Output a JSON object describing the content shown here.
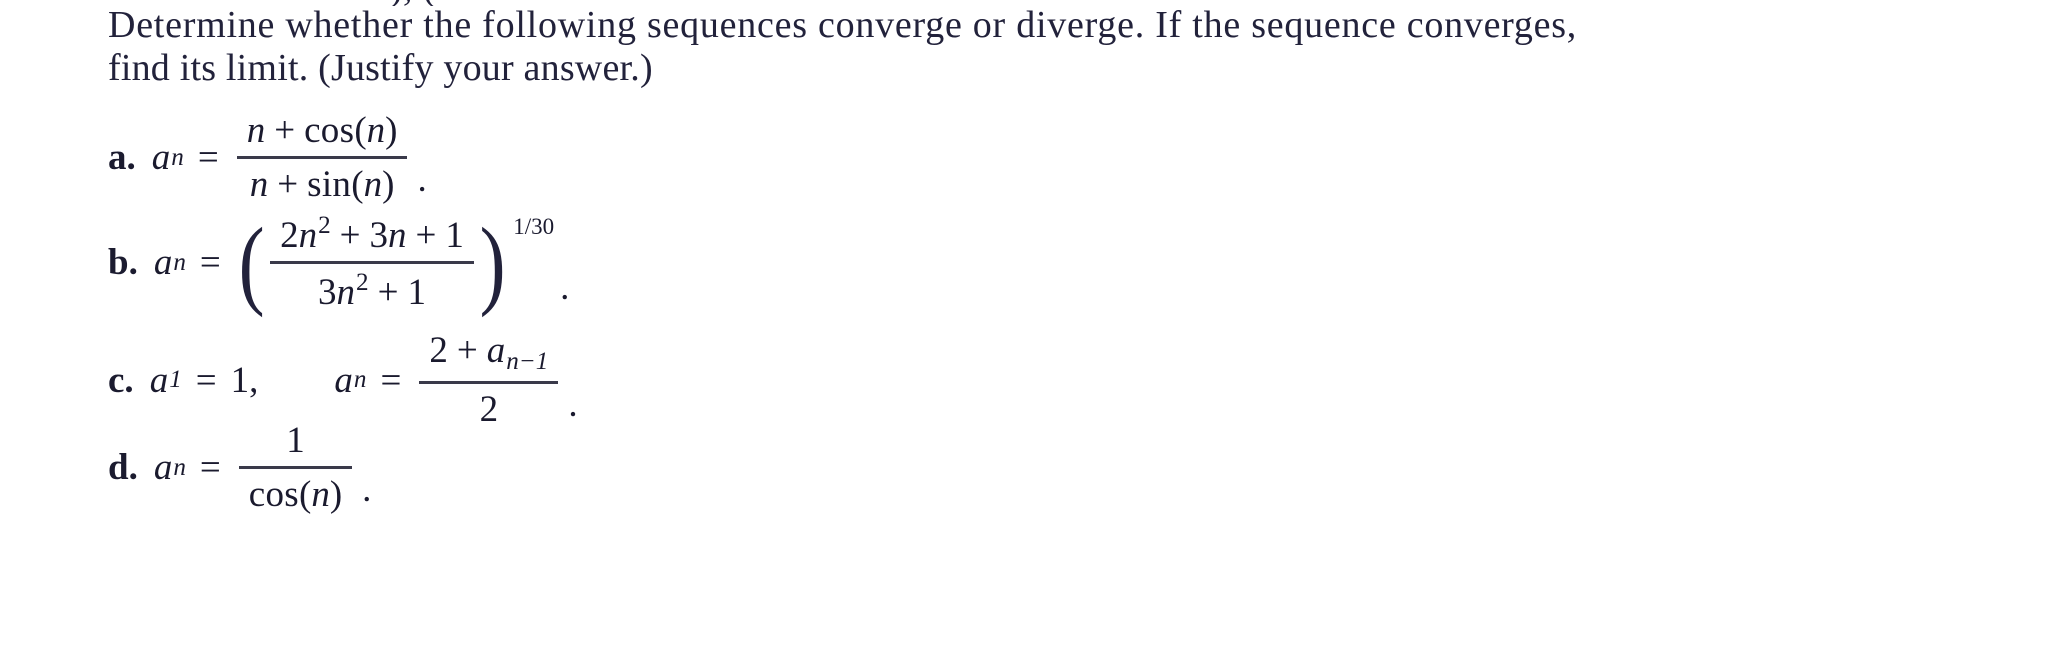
{
  "document": {
    "type": "math-homework-problem",
    "clipped_line_above": "),  (",
    "instructions": {
      "line1": "Determine whether the following sequences converge or diverge. If the sequence converges,",
      "line2": "find its limit. (Justify your answer.)"
    },
    "problems": [
      {
        "label": "a.",
        "id": "problem-a",
        "lhs": "a",
        "lhs_sub": "n",
        "relation": "=",
        "expression_type": "fraction",
        "numerator": "n + cos(n)",
        "denominator": "n + sin(n)",
        "trailing": ".",
        "latex": "a_n = \\frac{n+\\cos(n)}{n+\\sin(n)}."
      },
      {
        "label": "b.",
        "id": "problem-b",
        "lhs": "a",
        "lhs_sub": "n",
        "relation": "=",
        "expression_type": "fraction-power",
        "numerator": "2n^2 + 3n + 1",
        "denominator": "3n^2 + 1",
        "exponent": "1/30",
        "trailing": ".",
        "latex": "a_n = \\left(\\frac{2n^2+3n+1}{3n^2+1}\\right)^{1/30}."
      },
      {
        "label": "c.",
        "id": "problem-c",
        "initial_lhs": "a",
        "initial_sub": "1",
        "initial_relation": "=",
        "initial_value": "1,",
        "lhs": "a",
        "lhs_sub": "n",
        "relation": "=",
        "expression_type": "recursive-fraction",
        "numerator": "2 + a_{n-1}",
        "denominator": "2",
        "trailing": ".",
        "latex": "a_1 = 1, \\quad a_n = \\frac{2+a_{n-1}}{2}."
      },
      {
        "label": "d.",
        "id": "problem-d",
        "lhs": "a",
        "lhs_sub": "n",
        "relation": "=",
        "expression_type": "fraction",
        "numerator": "1",
        "denominator": "cos(n)",
        "trailing": ".",
        "latex": "a_n = \\frac{1}{\\cos(n)}."
      }
    ],
    "tokens": {
      "n": "n",
      "plus": "+",
      "equals": "=",
      "minus": "−",
      "one": "1",
      "two": "2",
      "three": "3",
      "cos": "cos",
      "sin": "sin",
      "lparen": "(",
      "rparen": ")",
      "period": ".",
      "comma": ",",
      "a": "a",
      "sub_n": "n",
      "sub_1": "1",
      "sub_n_minus_1": "n−1",
      "sq": "2",
      "exp_1_over_30": "1/30",
      "big_lparen": "(",
      "big_rparen": ")"
    }
  },
  "colors": {
    "page_background": "#ffffff",
    "text": "#22223b",
    "rule": "#3a3a4a"
  }
}
